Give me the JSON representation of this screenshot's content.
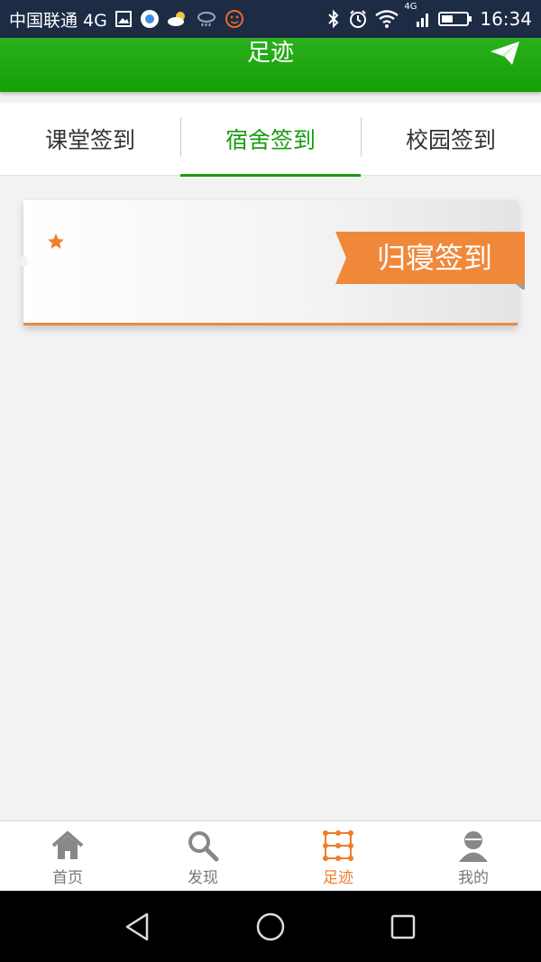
{
  "status_bar": {
    "carrier": "中国联通 4G",
    "network": "4G",
    "time": "16:34"
  },
  "header": {
    "title": "足迹"
  },
  "tabs": [
    {
      "label": "课堂签到",
      "active": false
    },
    {
      "label": "宿舍签到",
      "active": true
    },
    {
      "label": "校园签到",
      "active": false
    }
  ],
  "card": {
    "ribbon_label": "归寝签到",
    "accent_color": "#f0883a"
  },
  "bottom_nav": [
    {
      "label": "首页",
      "icon": "home-icon"
    },
    {
      "label": "发现",
      "icon": "search-icon"
    },
    {
      "label": "足迹",
      "icon": "footprint-grid-icon",
      "active": true
    },
    {
      "label": "我的",
      "icon": "user-icon"
    }
  ],
  "colors": {
    "brand_green": "#1a9c10",
    "accent_orange": "#ef7d2a",
    "status_bar_bg": "#1d2b45"
  }
}
